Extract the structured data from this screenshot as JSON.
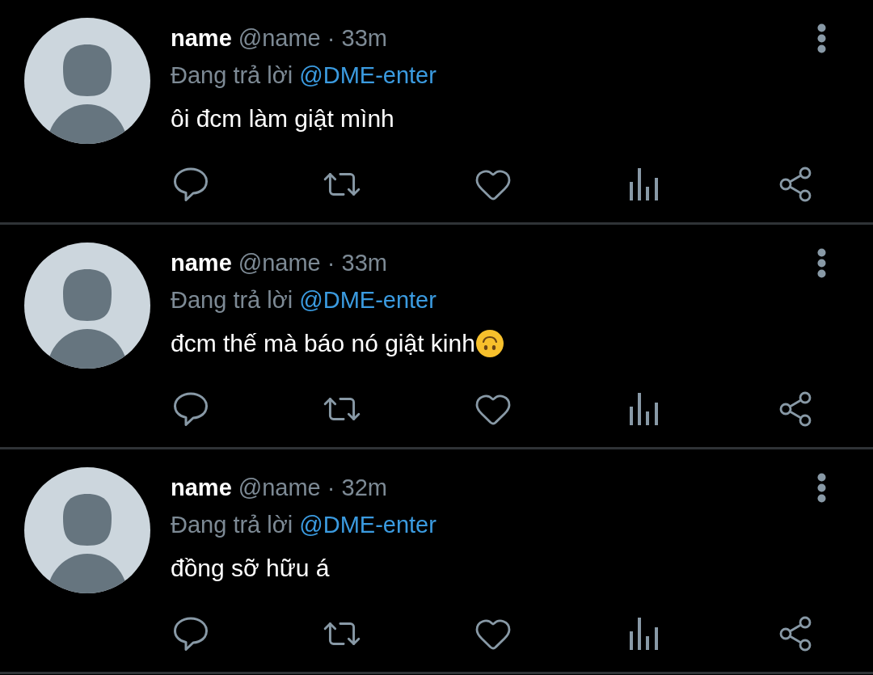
{
  "tweets": [
    {
      "display_name": "name",
      "meta": "@name · 33m",
      "reply_prefix": "Đang trả lời",
      "mention": "@DME-enter",
      "text": "ôi đcm làm giật mình",
      "trailing_emoji": false
    },
    {
      "display_name": "name",
      "meta": "@name · 33m",
      "reply_prefix": "Đang trả lời",
      "mention": "@DME-enter",
      "text": "đcm thế mà báo nó giật kinh",
      "trailing_emoji": true
    },
    {
      "display_name": "name",
      "meta": "@name · 32m",
      "reply_prefix": "Đang trả lời",
      "mention": "@DME-enter",
      "text": "đồng sỡ hữu á",
      "trailing_emoji": false
    }
  ]
}
